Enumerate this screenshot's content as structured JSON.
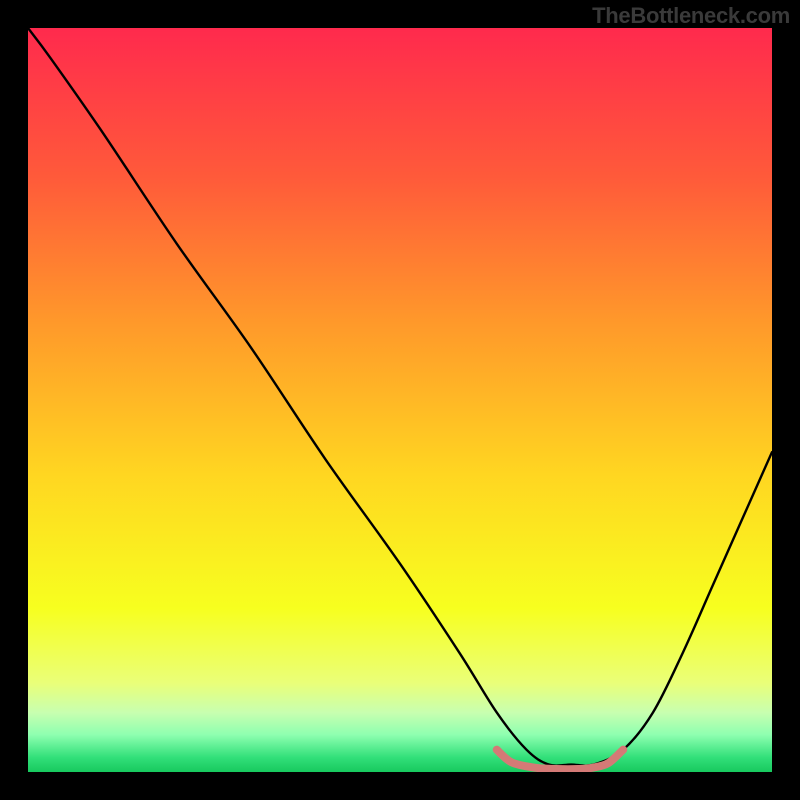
{
  "watermark": "TheBottleneck.com",
  "chart_data": {
    "type": "line",
    "title": "",
    "xlabel": "",
    "ylabel": "",
    "xlim": [
      0,
      100
    ],
    "ylim": [
      0,
      100
    ],
    "gradient_stops": [
      {
        "offset": 0.0,
        "color": "#ff2a4d"
      },
      {
        "offset": 0.2,
        "color": "#ff5a3a"
      },
      {
        "offset": 0.4,
        "color": "#ff9a2a"
      },
      {
        "offset": 0.6,
        "color": "#ffd621"
      },
      {
        "offset": 0.78,
        "color": "#f7ff1f"
      },
      {
        "offset": 0.88,
        "color": "#eaff78"
      },
      {
        "offset": 0.92,
        "color": "#c8ffb0"
      },
      {
        "offset": 0.95,
        "color": "#8effb0"
      },
      {
        "offset": 0.98,
        "color": "#33e07a"
      },
      {
        "offset": 1.0,
        "color": "#17c95e"
      }
    ],
    "series": [
      {
        "name": "bottleneck-curve",
        "color": "#000000",
        "x": [
          0,
          3,
          10,
          20,
          30,
          40,
          50,
          58,
          63,
          67,
          70,
          73,
          76,
          80,
          84,
          88,
          92,
          96,
          100
        ],
        "y": [
          100,
          96,
          86,
          71,
          57,
          42,
          28,
          16,
          8,
          3,
          1,
          1,
          1,
          3,
          8,
          16,
          25,
          34,
          43
        ]
      },
      {
        "name": "optimal-band",
        "color": "#d47a76",
        "x": [
          63,
          65,
          68,
          71,
          74,
          76,
          78,
          80
        ],
        "y": [
          3.0,
          1.3,
          0.6,
          0.4,
          0.4,
          0.6,
          1.2,
          3.0
        ]
      }
    ],
    "annotations": []
  }
}
